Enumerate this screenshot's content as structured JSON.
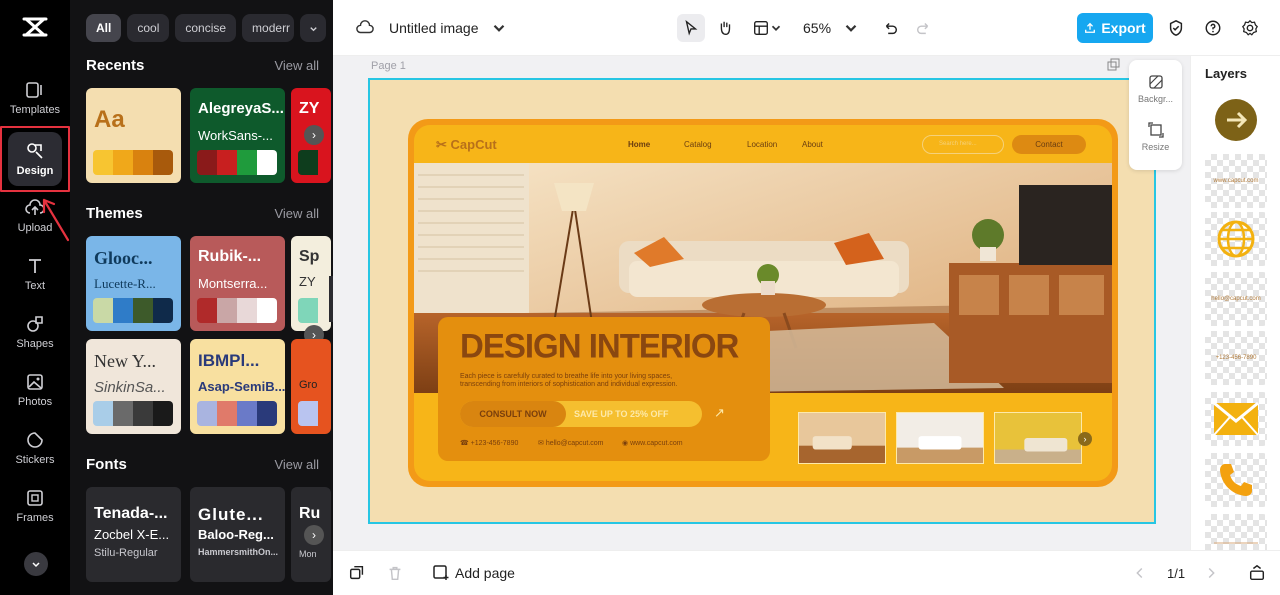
{
  "app": {
    "accent": "#16a7f0",
    "highlight": "#e5323f"
  },
  "rail": {
    "items": [
      {
        "label": "Templates",
        "icon": "templates-icon"
      },
      {
        "label": "Design",
        "icon": "design-icon"
      },
      {
        "label": "Upload",
        "icon": "upload-icon"
      },
      {
        "label": "Text",
        "icon": "text-icon"
      },
      {
        "label": "Shapes",
        "icon": "shapes-icon"
      },
      {
        "label": "Photos",
        "icon": "photos-icon"
      },
      {
        "label": "Stickers",
        "icon": "stickers-icon"
      },
      {
        "label": "Frames",
        "icon": "frames-icon"
      }
    ]
  },
  "panel": {
    "chips": [
      "All",
      "cool",
      "concise",
      "moderr"
    ],
    "recents": {
      "title": "Recents",
      "view_all": "View all",
      "cards": [
        {
          "t1": "Aa",
          "t2": ""
        },
        {
          "t1": "AlegreyaS...",
          "t2": "WorkSans-..."
        },
        {
          "t1": "ZY",
          "t2": ""
        }
      ]
    },
    "themes": {
      "title": "Themes",
      "view_all": "View all",
      "cards": [
        {
          "t1": "Glooc...",
          "t2": "Lucette-R..."
        },
        {
          "t1": "Rubik-...",
          "t2": "Montserra..."
        },
        {
          "t1": "Sp",
          "t2": "ZY"
        },
        {
          "t1": "New Y...",
          "t2": "SinkinSa..."
        },
        {
          "t1": "IBMPl...",
          "t2": "Asap-SemiB..."
        },
        {
          "t1": "",
          "t2": "Gro"
        }
      ]
    },
    "fonts": {
      "title": "Fonts",
      "view_all": "View all",
      "cards": [
        {
          "f1": "Tenada-...",
          "f2": "Zocbel X-E...",
          "f3": "Stilu-Regular"
        },
        {
          "f1": "Glute...",
          "f2": "Baloo-Reg...",
          "f3": "HammersmithOn..."
        },
        {
          "f1": "Ru",
          "f2": "",
          "f3": "Mon"
        }
      ]
    }
  },
  "topbar": {
    "title": "Untitled image",
    "zoom": "65%",
    "export": "Export"
  },
  "canvas": {
    "page_label": "Page 1",
    "tools": [
      {
        "label": "Backgr..."
      },
      {
        "label": "Resize"
      }
    ],
    "design": {
      "brand": "CapCut",
      "nav": [
        "Home",
        "Catalog",
        "Location",
        "About"
      ],
      "search_placeholder": "Search here...",
      "contact": "Contact",
      "title": "DESIGN INTERIOR",
      "desc_line1": "Each piece is carefully curated to breathe life into your living spaces,",
      "desc_line2": "transcending from interiors of sophistication and individual expression.",
      "cta_consult": "CONSULT NOW",
      "cta_save": "SAVE UP TO 25% OFF",
      "phone": "+123-456-7890",
      "email": "hello@capcut.com",
      "web": "www.capcut.com"
    }
  },
  "layers": {
    "title": "Layers",
    "items": [
      "arrow-circle",
      "www.capcut.com",
      "globe-icon",
      "hello@capcut.com",
      "+123-456-7890",
      "mail-icon",
      "phone-icon",
      "line"
    ]
  },
  "bottombar": {
    "add_page": "Add page",
    "page_count": "1/1"
  }
}
